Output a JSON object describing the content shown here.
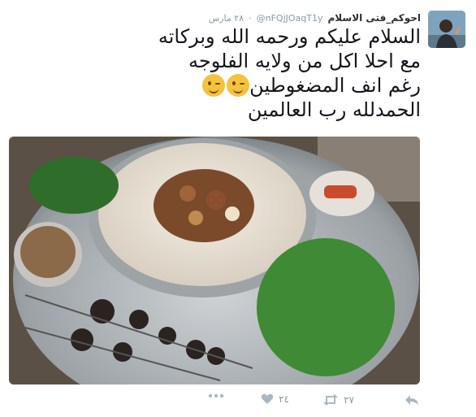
{
  "tweet": {
    "author": {
      "name": "احوكم_فتى الاسلام",
      "handle": "@nFQjJOaqT1y"
    },
    "timestamp": "٢٨ مارس",
    "separator": "·",
    "text_lines": [
      "السلام عليكم ورحمه الله وبركاته",
      "مع احلا اكل من ولايه الفلوجه",
      "رغم انف المضغوطين",
      "الحمدلله رب العالمين"
    ],
    "emoji": [
      "winking-face",
      "winking-face"
    ],
    "media": {
      "type": "photo"
    },
    "actions": {
      "reply_icon": "reply-icon",
      "retweet_icon": "retweet-icon",
      "retweet_count": "٢٧",
      "like_icon": "heart-icon",
      "like_count": "٢٤",
      "more_icon": "more-icon"
    }
  },
  "colors": {
    "text": "#14171a",
    "meta": "#8899a6",
    "icon": "#aab8c2",
    "emoji": "#f5c33b"
  }
}
